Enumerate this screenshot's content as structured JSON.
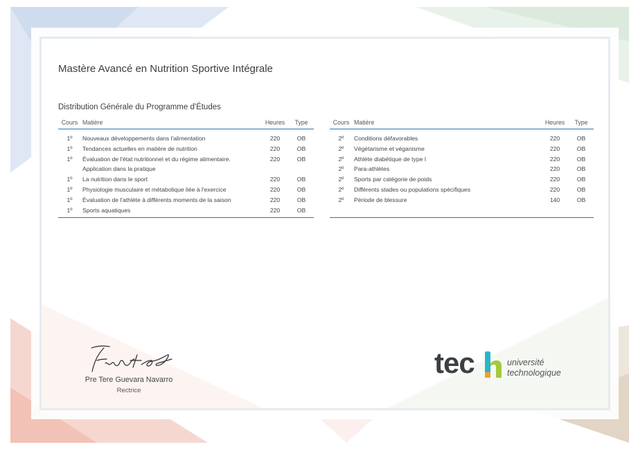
{
  "document": {
    "title": "Mastère Avancé en Nutrition Sportive Intégrale",
    "subtitle": "Distribution Générale du Programme d'Études"
  },
  "table_headers": {
    "cours": "Cours",
    "matiere": "Matière",
    "heures": "Heures",
    "type": "Type"
  },
  "left_rows": [
    {
      "cours": "1º",
      "matiere": "Nouveaux développements dans l'alimentation",
      "heures": "220",
      "type": "OB"
    },
    {
      "cours": "1º",
      "matiere": "Tendances actuelles en matière de nutrition",
      "heures": "220",
      "type": "OB"
    },
    {
      "cours": "1º",
      "matiere": "Évaluation de l'état nutritionnel et du régime alimentaire.",
      "heures": "220",
      "type": "OB"
    },
    {
      "cours": "",
      "matiere": "Application dans la pratique",
      "heures": "",
      "type": ""
    },
    {
      "cours": "1º",
      "matiere": "La nutrition dans le sport",
      "heures": "220",
      "type": "OB"
    },
    {
      "cours": "1º",
      "matiere": "Physiologie musculaire et métabolique liée à l'exercice",
      "heures": "220",
      "type": "OB"
    },
    {
      "cours": "1º",
      "matiere": "Évaluation de l'athlète à différents moments de la saison",
      "heures": "220",
      "type": "OB"
    },
    {
      "cours": "1º",
      "matiere": "Sports aquatiques",
      "heures": "220",
      "type": "OB"
    }
  ],
  "right_rows": [
    {
      "cours": "2º",
      "matiere": "Conditions défavorables",
      "heures": "220",
      "type": "OB"
    },
    {
      "cours": "2º",
      "matiere": "Végétarisme et véganisme",
      "heures": "220",
      "type": "OB"
    },
    {
      "cours": "2º",
      "matiere": "Athlète diabétique de type I",
      "heures": "220",
      "type": "OB"
    },
    {
      "cours": "2º",
      "matiere": "Para-athlètes",
      "heures": "220",
      "type": "OB"
    },
    {
      "cours": "2º",
      "matiere": "Sports par catégorie de poids",
      "heures": "220",
      "type": "OB"
    },
    {
      "cours": "2º",
      "matiere": "Différents stades ou populations spécifiques",
      "heures": "220",
      "type": "OB"
    },
    {
      "cours": "2º",
      "matiere": "Période de blessure",
      "heures": "140",
      "type": "OB"
    }
  ],
  "signature": {
    "name": "Pre Tere Guevara Navarro",
    "role": "Rectrice"
  },
  "logo": {
    "wordmark": "tec",
    "tagline_1": "université",
    "tagline_2": "technologique",
    "accent_colors": [
      "#2bb5c9",
      "#a6c83c",
      "#f0a12a"
    ]
  },
  "colors": {
    "rule": "#2f72ad",
    "text": "#3d3d3d"
  }
}
